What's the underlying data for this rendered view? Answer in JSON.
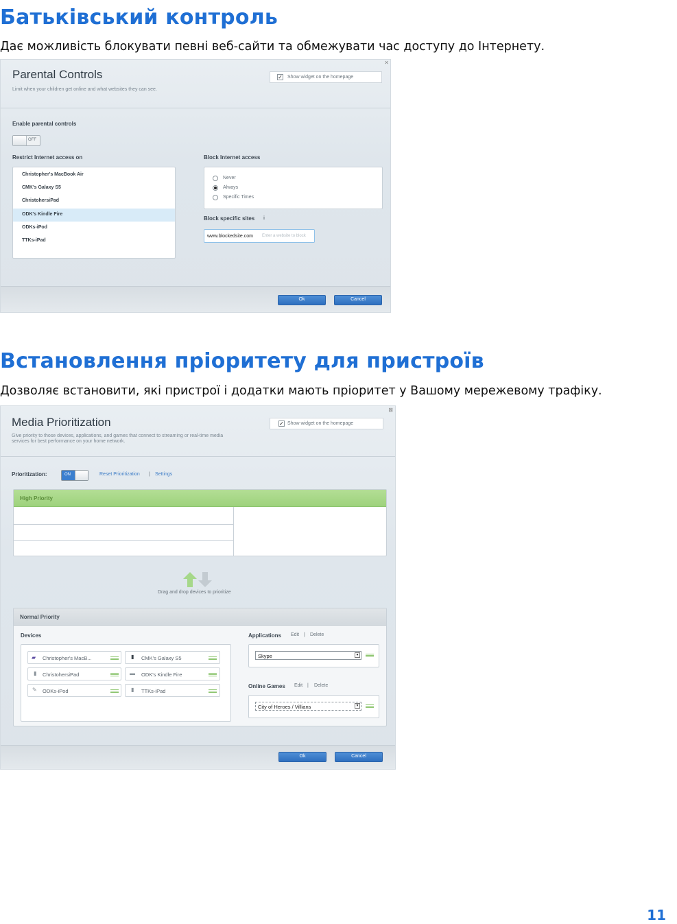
{
  "section1": {
    "heading": "Батьківський контроль",
    "description": "Дає можливість блокувати певні веб-сайти та обмежувати час доступу до Інтернету."
  },
  "parental": {
    "title": "Parental Controls",
    "subtitle": "Limit when your children get online and what websites they can see.",
    "widget_label": "Show widget on the homepage",
    "enable_label": "Enable parental controls",
    "toggle_state": "OFF",
    "restrict_label": "Restrict Internet access on",
    "devices": [
      "Christopher's MacBook Air",
      "CMK's Galaxy S5",
      "ChristohersiPad",
      "ODK's Kindle Fire",
      "ODKs-iPod",
      "TTKs-iPad"
    ],
    "block_access_label": "Block Internet access",
    "options": [
      "Never",
      "Always",
      "Specific Times"
    ],
    "block_sites_label": "Block specific sites",
    "site_value": "www.blockedsite.com",
    "site_placeholder": "Enter a website to block",
    "ok_label": "Ok",
    "cancel_label": "Cancel"
  },
  "section2": {
    "heading": "Встановлення пріоритету для пристроїв",
    "description": "Дозволяє встановити, які пристрої і додатки мають пріоритет у Вашому мережевому трафіку."
  },
  "media": {
    "title": "Media Prioritization",
    "subtitle_1": "Give priority to those devices, applications, and games that connect to streaming or real-time media",
    "subtitle_2": "services for best performance on your home network.",
    "widget_label": "Show widget on the homepage",
    "prioritization_label": "Prioritization:",
    "toggle_state": "ON",
    "reset_link": "Reset Prioritization",
    "settings_link": "Settings",
    "high_priority": "High Priority",
    "drag_hint": "Drag and drop devices to prioritize",
    "normal_priority": "Normal Priority",
    "devices_label": "Devices",
    "devices": [
      "Christopher's MacB...",
      "CMK's Galaxy S5",
      "ChristohersiPad",
      "ODK's Kindle Fire",
      "ODKs-iPod",
      "TTKs-iPad"
    ],
    "applications_label": "Applications",
    "edit_label": "Edit",
    "delete_label": "Delete",
    "app_value": "Skype",
    "games_label": "Online Games",
    "game_value": "City of Heroes / Villians",
    "ok_label": "Ok",
    "cancel_label": "Cancel"
  },
  "page_number": "11",
  "colors": {
    "heading": "#1f6fd4",
    "high_priority": "#9ed27d",
    "button": "#3a7cc9"
  }
}
